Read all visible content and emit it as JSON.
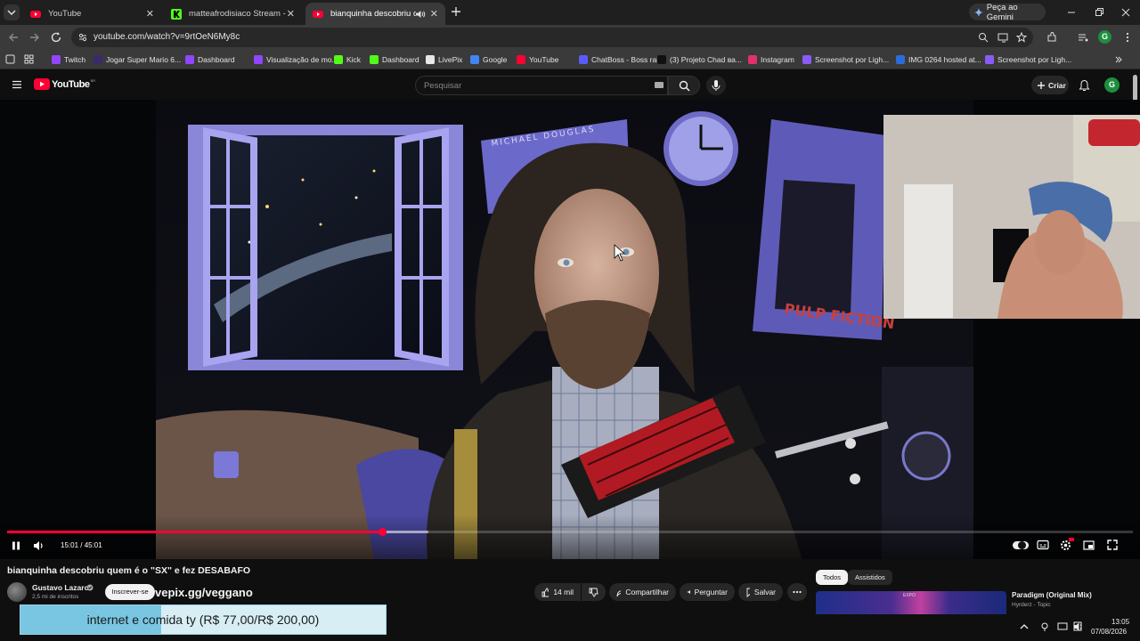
{
  "browser": {
    "tabs": [
      {
        "title": "YouTube",
        "icon": "youtube-icon"
      },
      {
        "title": "matteafrodisiaco Stream - Watch",
        "icon": "kick-icon"
      },
      {
        "title": "bianquinha descobriu quem é o",
        "icon": "youtube-icon"
      }
    ],
    "gemini_label": "Peça ao Gemini",
    "profile_initial": "G",
    "url": "youtube.com/watch?v=9rtOeN6My8c",
    "bookmarks": [
      {
        "label": "Twitch",
        "color": "#9146ff"
      },
      {
        "label": "Jogar Super Mario 6...",
        "color": "#3a2a6a"
      },
      {
        "label": "Dashboard",
        "color": "#9146ff"
      },
      {
        "label": "Visualização de mo...",
        "color": "#9146ff"
      },
      {
        "label": "Kick",
        "color": "#53fc18"
      },
      {
        "label": "Dashboard",
        "color": "#53fc18"
      },
      {
        "label": "LivePix",
        "color": "#e8e8e8"
      },
      {
        "label": "Google",
        "color": "#4285f4"
      },
      {
        "label": "YouTube",
        "color": "#ff0033"
      },
      {
        "label": "ChatBoss - Boss rai...",
        "color": "#5a5aff"
      },
      {
        "label": "(3) Projeto Chad ва...",
        "color": "#111111"
      },
      {
        "label": "Instagram",
        "color": "#e1306c"
      },
      {
        "label": "Screenshot por Ligh...",
        "color": "#8a5cf6"
      },
      {
        "label": "IMG 0264 hosted at...",
        "color": "#2b6cd9"
      },
      {
        "label": "Screenshot por Ligh...",
        "color": "#8a5cf6"
      }
    ]
  },
  "youtube": {
    "logo_text": "YouTube",
    "logo_badge": "BR",
    "search_placeholder": "Pesquisar",
    "create_label": "Criar",
    "avatar_initial": "G",
    "player": {
      "time": "15:01 / 45:01",
      "progress_fraction": 0.333,
      "buffered_fraction": 0.374
    },
    "video_title": "bianquinha descobriu quem é o \"SX\" e fez DESABAFO",
    "channel_name": "Gustavo Lazaro",
    "subscribers": "2,5 mi de inscritos",
    "subscribe_label": "Inscrever-se",
    "overlay_link": "vepix.gg/veggano",
    "likes": "14 mil",
    "share_label": "Compartilhar",
    "ask_label": "Perguntar",
    "save_label": "Salvar",
    "chips": [
      "Todos",
      "Assistidos"
    ],
    "reco_title": "Paradigm (Original Mix)",
    "reco_channel": "Hyrderz - Topic",
    "donation_text": "internet e comida ty (R$ 77,00/R$ 200,00)",
    "donation_fraction": 0.385,
    "poster_text": "MICHAEL DOUGLAS",
    "poster2_text": "PULP FICTION"
  },
  "taskbar": {
    "time": "13:05",
    "date": "07/08/2026"
  },
  "colors": {
    "accent_red": "#ff0033",
    "chrome_bg": "#1f1f1f",
    "toolbar_bg": "#3a3a3a",
    "yt_bg": "#0f0f0f",
    "profile_green": "#1e8e3e"
  }
}
